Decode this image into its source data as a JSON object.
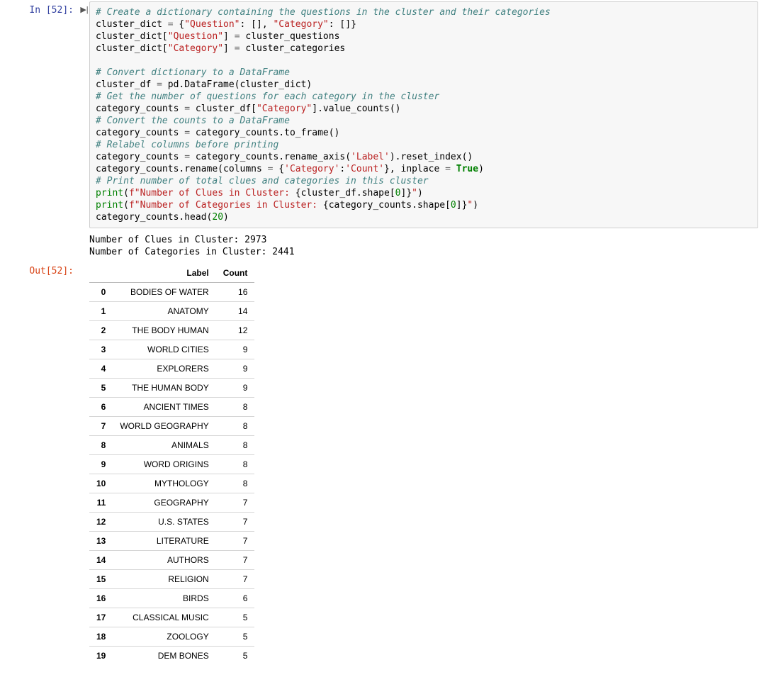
{
  "input_prompt": "In [52]:",
  "output_prompt": "Out[52]:",
  "code_lines": [
    [
      {
        "t": "# Create a dictionary containing the questions in the cluster and their categories",
        "c": "c"
      }
    ],
    [
      {
        "t": "cluster_dict ",
        "c": "n"
      },
      {
        "t": "=",
        "c": "o"
      },
      {
        "t": " {",
        "c": "n"
      },
      {
        "t": "\"Question\"",
        "c": "s"
      },
      {
        "t": ": [], ",
        "c": "n"
      },
      {
        "t": "\"Category\"",
        "c": "s"
      },
      {
        "t": ": []}",
        "c": "n"
      }
    ],
    [
      {
        "t": "cluster_dict[",
        "c": "n"
      },
      {
        "t": "\"Question\"",
        "c": "s"
      },
      {
        "t": "] ",
        "c": "n"
      },
      {
        "t": "=",
        "c": "o"
      },
      {
        "t": " cluster_questions",
        "c": "n"
      }
    ],
    [
      {
        "t": "cluster_dict[",
        "c": "n"
      },
      {
        "t": "\"Category\"",
        "c": "s"
      },
      {
        "t": "] ",
        "c": "n"
      },
      {
        "t": "=",
        "c": "o"
      },
      {
        "t": " cluster_categories",
        "c": "n"
      }
    ],
    [
      {
        "t": "",
        "c": "n"
      }
    ],
    [
      {
        "t": "# Convert dictionary to a DataFrame",
        "c": "c"
      }
    ],
    [
      {
        "t": "cluster_df ",
        "c": "n"
      },
      {
        "t": "=",
        "c": "o"
      },
      {
        "t": " pd.DataFrame(cluster_dict)",
        "c": "n"
      }
    ],
    [
      {
        "t": "# Get the number of questions for each category in the cluster",
        "c": "c"
      }
    ],
    [
      {
        "t": "category_counts ",
        "c": "n"
      },
      {
        "t": "=",
        "c": "o"
      },
      {
        "t": " cluster_df[",
        "c": "n"
      },
      {
        "t": "\"Category\"",
        "c": "s"
      },
      {
        "t": "].value_counts()",
        "c": "n"
      }
    ],
    [
      {
        "t": "# Convert the counts to a DataFrame",
        "c": "c"
      }
    ],
    [
      {
        "t": "category_counts ",
        "c": "n"
      },
      {
        "t": "=",
        "c": "o"
      },
      {
        "t": " category_counts.to_frame()",
        "c": "n"
      }
    ],
    [
      {
        "t": "# Relabel columns before printing",
        "c": "c"
      }
    ],
    [
      {
        "t": "category_counts ",
        "c": "n"
      },
      {
        "t": "=",
        "c": "o"
      },
      {
        "t": " category_counts.rename_axis(",
        "c": "n"
      },
      {
        "t": "'Label'",
        "c": "s"
      },
      {
        "t": ").reset_index()",
        "c": "n"
      }
    ],
    [
      {
        "t": "category_counts.rename(columns ",
        "c": "n"
      },
      {
        "t": "=",
        "c": "o"
      },
      {
        "t": " {",
        "c": "n"
      },
      {
        "t": "'Category'",
        "c": "s"
      },
      {
        "t": ":",
        "c": "n"
      },
      {
        "t": "'Count'",
        "c": "s"
      },
      {
        "t": "}, inplace ",
        "c": "n"
      },
      {
        "t": "=",
        "c": "o"
      },
      {
        "t": " ",
        "c": "n"
      },
      {
        "t": "True",
        "c": "kc"
      },
      {
        "t": ")",
        "c": "n"
      }
    ],
    [
      {
        "t": "# Print number of total clues and categories in this cluster",
        "c": "c"
      }
    ],
    [
      {
        "t": "print",
        "c": "nb"
      },
      {
        "t": "(",
        "c": "n"
      },
      {
        "t": "f\"Number of Clues in Cluster: ",
        "c": "s"
      },
      {
        "t": "{cluster_df.shape[",
        "c": "n"
      },
      {
        "t": "0",
        "c": "mi"
      },
      {
        "t": "]}",
        "c": "n"
      },
      {
        "t": "\"",
        "c": "s"
      },
      {
        "t": ")",
        "c": "n"
      }
    ],
    [
      {
        "t": "print",
        "c": "nb"
      },
      {
        "t": "(",
        "c": "n"
      },
      {
        "t": "f\"Number of Categories in Cluster: ",
        "c": "s"
      },
      {
        "t": "{category_counts.shape[",
        "c": "n"
      },
      {
        "t": "0",
        "c": "mi"
      },
      {
        "t": "]}",
        "c": "n"
      },
      {
        "t": "\"",
        "c": "s"
      },
      {
        "t": ")",
        "c": "n"
      }
    ],
    [
      {
        "t": "category_counts.head(",
        "c": "n"
      },
      {
        "t": "20",
        "c": "mi"
      },
      {
        "t": ")",
        "c": "n"
      }
    ]
  ],
  "stdout": "Number of Clues in Cluster: 2973\nNumber of Categories in Cluster: 2441",
  "table": {
    "columns": [
      "Label",
      "Count"
    ],
    "rows": [
      {
        "i": "0",
        "label": "BODIES OF WATER",
        "count": "16"
      },
      {
        "i": "1",
        "label": "ANATOMY",
        "count": "14"
      },
      {
        "i": "2",
        "label": "THE BODY HUMAN",
        "count": "12"
      },
      {
        "i": "3",
        "label": "WORLD CITIES",
        "count": "9"
      },
      {
        "i": "4",
        "label": "EXPLORERS",
        "count": "9"
      },
      {
        "i": "5",
        "label": "THE HUMAN BODY",
        "count": "9"
      },
      {
        "i": "6",
        "label": "ANCIENT TIMES",
        "count": "8"
      },
      {
        "i": "7",
        "label": "WORLD GEOGRAPHY",
        "count": "8"
      },
      {
        "i": "8",
        "label": "ANIMALS",
        "count": "8"
      },
      {
        "i": "9",
        "label": "WORD ORIGINS",
        "count": "8"
      },
      {
        "i": "10",
        "label": "MYTHOLOGY",
        "count": "8"
      },
      {
        "i": "11",
        "label": "GEOGRAPHY",
        "count": "7"
      },
      {
        "i": "12",
        "label": "U.S. STATES",
        "count": "7"
      },
      {
        "i": "13",
        "label": "LITERATURE",
        "count": "7"
      },
      {
        "i": "14",
        "label": "AUTHORS",
        "count": "7"
      },
      {
        "i": "15",
        "label": "RELIGION",
        "count": "7"
      },
      {
        "i": "16",
        "label": "BIRDS",
        "count": "6"
      },
      {
        "i": "17",
        "label": "CLASSICAL MUSIC",
        "count": "5"
      },
      {
        "i": "18",
        "label": "ZOOLOGY",
        "count": "5"
      },
      {
        "i": "19",
        "label": "DEM BONES",
        "count": "5"
      }
    ]
  }
}
